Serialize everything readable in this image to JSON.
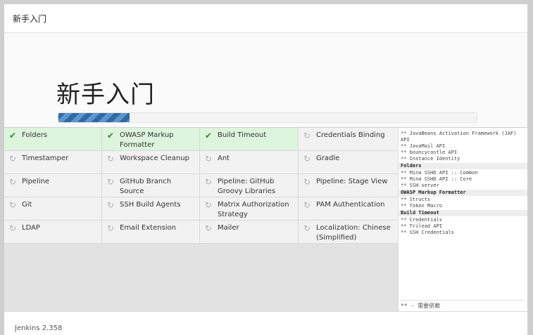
{
  "window": {
    "title": "新手入门"
  },
  "hero": {
    "title": "新手入门",
    "progress_percent": 17
  },
  "plugins": [
    {
      "name": "Folders",
      "status": "done"
    },
    {
      "name": "OWASP Markup Formatter",
      "status": "done"
    },
    {
      "name": "Build Timeout",
      "status": "done"
    },
    {
      "name": "Credentials Binding",
      "status": "pending"
    },
    {
      "name": "Timestamper",
      "status": "pending"
    },
    {
      "name": "Workspace Cleanup",
      "status": "pending"
    },
    {
      "name": "Ant",
      "status": "pending"
    },
    {
      "name": "Gradle",
      "status": "pending"
    },
    {
      "name": "Pipeline",
      "status": "pending"
    },
    {
      "name": "GitHub Branch Source",
      "status": "pending"
    },
    {
      "name": "Pipeline: GitHub Groovy Libraries",
      "status": "pending"
    },
    {
      "name": "Pipeline: Stage View",
      "status": "pending"
    },
    {
      "name": "Git",
      "status": "pending"
    },
    {
      "name": "SSH Build Agents",
      "status": "pending"
    },
    {
      "name": "Matrix Authorization Strategy",
      "status": "pending"
    },
    {
      "name": "PAM Authentication",
      "status": "pending"
    },
    {
      "name": "LDAP",
      "status": "pending"
    },
    {
      "name": "Email Extension",
      "status": "pending"
    },
    {
      "name": "Mailer",
      "status": "pending"
    },
    {
      "name": "Localization: Chinese (Simplified)",
      "status": "pending"
    }
  ],
  "log": {
    "lines": [
      {
        "text": "** JavaBeans Activation Framework (JAF) API",
        "head": false
      },
      {
        "text": "** JavaMail API",
        "head": false
      },
      {
        "text": "** bouncycastle API",
        "head": false
      },
      {
        "text": "** Instance Identity",
        "head": false
      },
      {
        "text": "Folders",
        "head": true
      },
      {
        "text": "** Mina SSHD API :: Common",
        "head": false
      },
      {
        "text": "** Mina SSHD API :: Core",
        "head": false
      },
      {
        "text": "** SSH server",
        "head": false
      },
      {
        "text": "OWASP Markup Formatter",
        "head": true
      },
      {
        "text": "** Structs",
        "head": false
      },
      {
        "text": "** Token Macro",
        "head": false
      },
      {
        "text": "Build Timeout",
        "head": true
      },
      {
        "text": "** Credentials",
        "head": false
      },
      {
        "text": "** Trilead API",
        "head": false
      },
      {
        "text": "** SSH Credentials",
        "head": false
      }
    ],
    "footer": "** - 需要依赖"
  },
  "footer": {
    "version": "Jenkins 2.358"
  },
  "icons": {
    "done": "check-icon",
    "pending": "refresh-icon"
  },
  "colors": {
    "done_bg": "#ddf4dd",
    "check": "#2d8c2d",
    "progress": "#2f6aa4"
  }
}
